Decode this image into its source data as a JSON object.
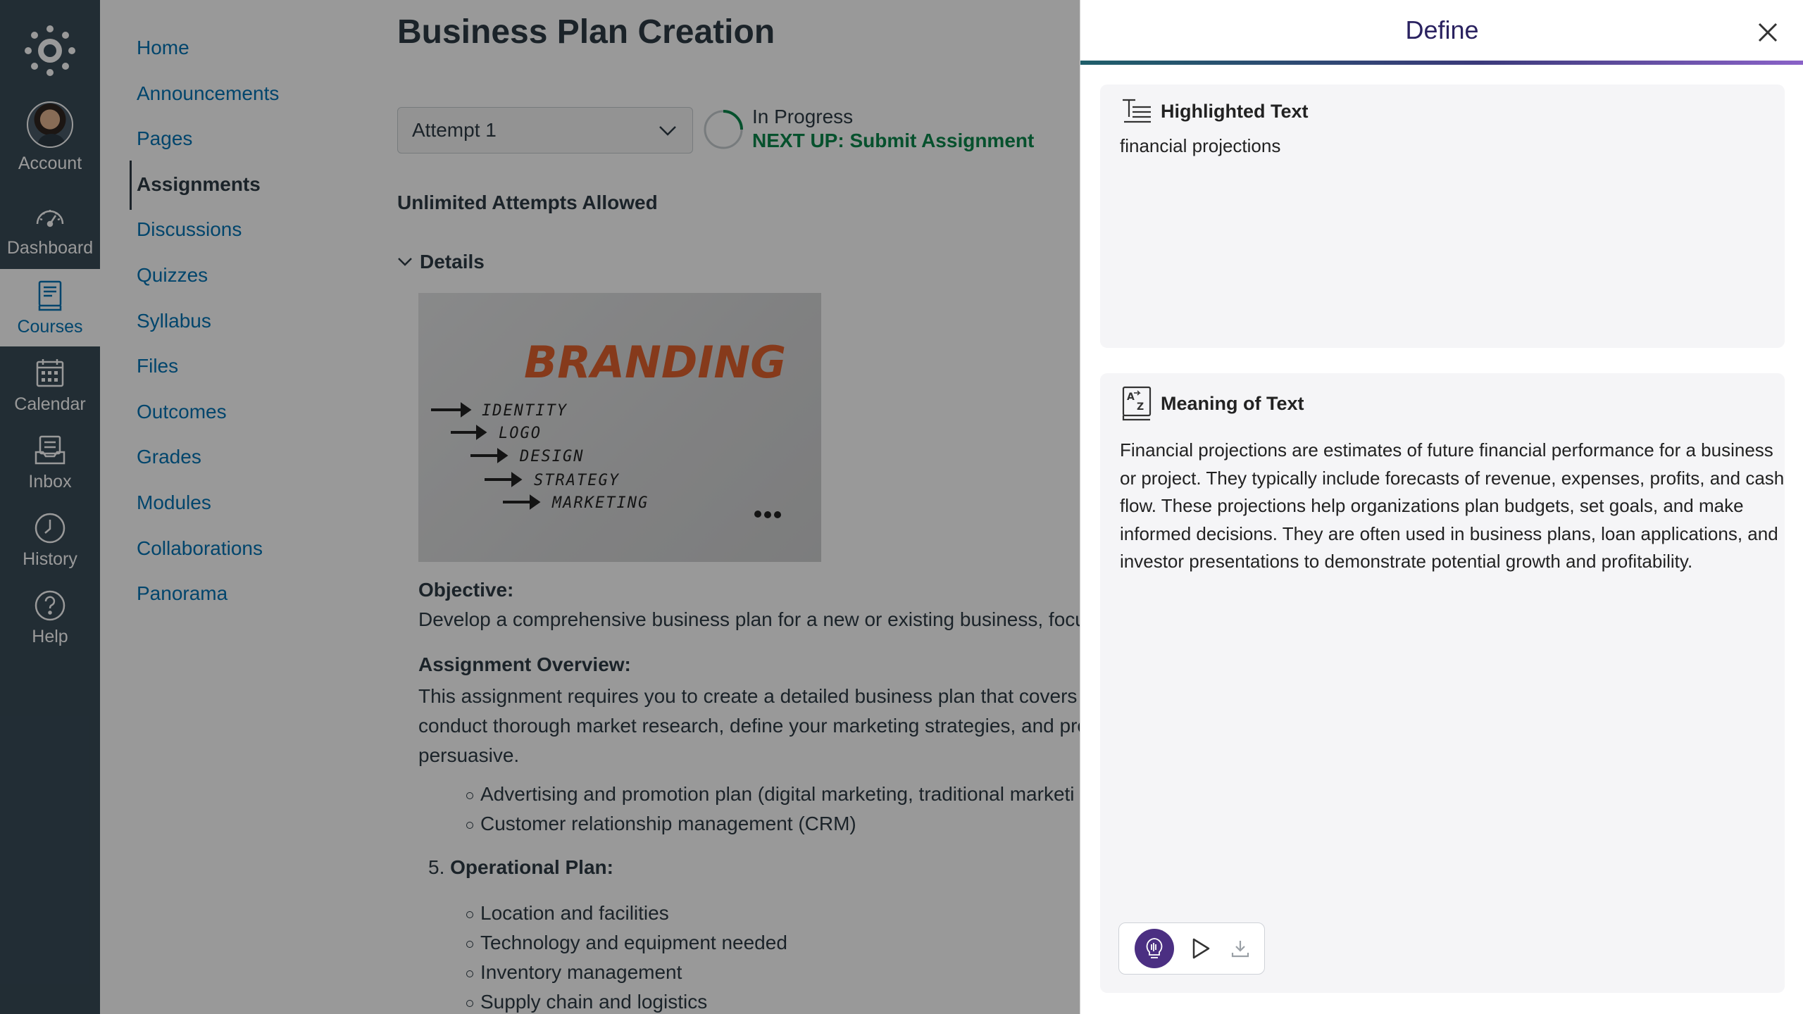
{
  "global_nav": {
    "account": "Account",
    "dashboard": "Dashboard",
    "courses": "Courses",
    "calendar": "Calendar",
    "inbox": "Inbox",
    "history": "History",
    "help": "Help"
  },
  "course_nav": {
    "items": [
      "Home",
      "Announcements",
      "Pages",
      "Assignments",
      "Discussions",
      "Quizzes",
      "Syllabus",
      "Files",
      "Outcomes",
      "Grades",
      "Modules",
      "Collaborations",
      "Panorama"
    ],
    "active": "Assignments"
  },
  "main": {
    "title": "Business Plan Creation",
    "attempt_select": "Attempt 1",
    "status": "In Progress",
    "next_up": "NEXT UP: Submit Assignment",
    "attempts_allowed": "Unlimited Attempts Allowed",
    "details_label": "Details",
    "image": {
      "title": "BRANDING",
      "items": [
        "IDENTITY",
        "LOGO",
        "DESIGN",
        "STRATEGY",
        "MARKETING"
      ]
    },
    "objective_heading": "Objective:",
    "objective_text": "Develop a comprehensive business plan for a new or existing business, focus",
    "overview_heading": "Assignment Overview:",
    "overview_lines": [
      "This assignment requires you to create a detailed business plan that covers th",
      "conduct thorough market research, define your marketing strategies, and pre",
      "persuasive."
    ],
    "marketing_bullets": [
      "Advertising and promotion plan (digital marketing, traditional marketi",
      "Customer relationship management (CRM)"
    ],
    "operational_number": "5.",
    "operational_heading": "Operational Plan:",
    "operational_bullets": [
      "Location and facilities",
      "Technology and equipment needed",
      "Inventory management",
      "Supply chain and logistics"
    ]
  },
  "define_panel": {
    "title": "Define",
    "highlighted_heading": "Highlighted Text",
    "highlighted_text": "financial projections",
    "meaning_heading": "Meaning of Text",
    "meaning_lines": [
      "Financial projections are estimates of future financial performance for a business",
      "or project. They typically include forecasts of revenue, expenses, profits, and cash",
      "flow. These projections help organizations plan budgets, set goals, and make",
      "informed decisions. They are often used in business plans, loan applications, and",
      "investor presentations to demonstrate potential growth and profitability."
    ],
    "accent_color": "#4b2f82"
  }
}
